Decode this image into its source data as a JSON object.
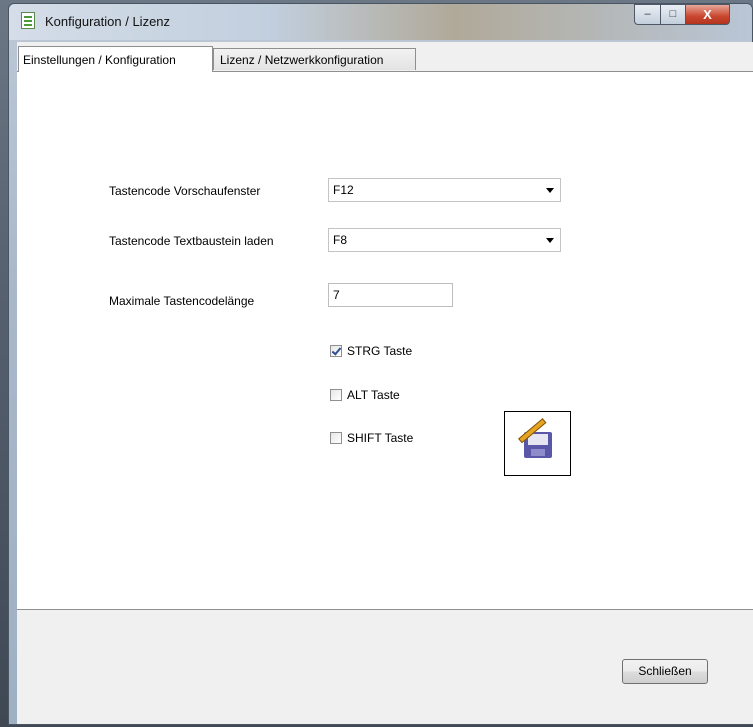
{
  "window": {
    "title": "Konfiguration / Lizenz"
  },
  "title_buttons": {
    "minimize": "–",
    "maximize": "□",
    "close": "X"
  },
  "tabs": [
    {
      "label": "Einstellungen / Konfiguration",
      "selected": true
    },
    {
      "label": "Lizenz / Netzwerkkonfiguration",
      "selected": false
    }
  ],
  "settings": {
    "preview_key": {
      "label": "Tastencode Vorschaufenster",
      "value": "F12"
    },
    "textblock_key": {
      "label": "Tastencode Textbaustein laden",
      "value": "F8"
    },
    "max_length": {
      "label": "Maximale Tastencodelänge",
      "value": "7"
    },
    "strg": {
      "label": "STRG Taste",
      "checked": true
    },
    "alt": {
      "label": "ALT Taste",
      "checked": false
    },
    "shift": {
      "label": "SHIFT Taste",
      "checked": false
    }
  },
  "icons": {
    "save": "save-edit-icon",
    "app": "document-icon"
  },
  "footer": {
    "close_label": "Schließen"
  }
}
